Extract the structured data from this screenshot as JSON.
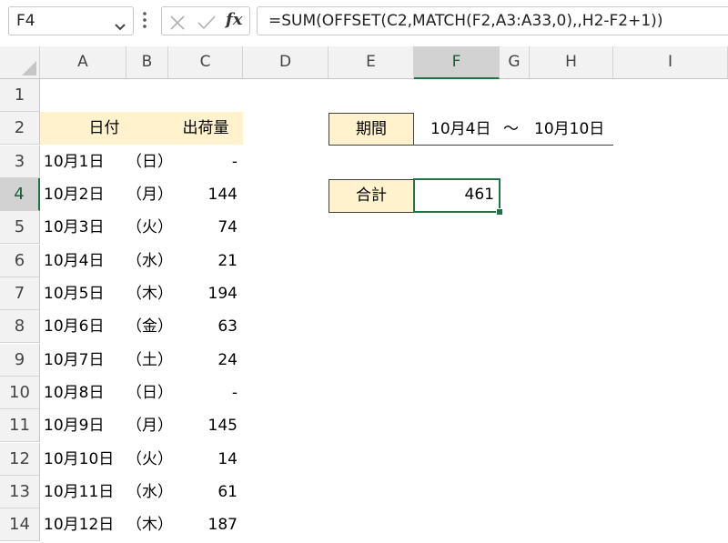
{
  "name_box": {
    "value": "F4"
  },
  "formula_bar": {
    "formula": "=SUM(OFFSET(C2,MATCH(F2,A3:A33,0),,H2-F2+1))"
  },
  "columns": [
    "A",
    "B",
    "C",
    "D",
    "E",
    "F",
    "G",
    "H",
    "I"
  ],
  "selected_column": "F",
  "rows": [
    "1",
    "2",
    "3",
    "4",
    "5",
    "6",
    "7",
    "8",
    "9",
    "10",
    "11",
    "12",
    "13",
    "14"
  ],
  "selected_row": "4",
  "table": {
    "header_date": "日付",
    "header_qty": "出荷量",
    "rows": [
      {
        "date": "10月1日",
        "weekday": "（日）",
        "qty": "-"
      },
      {
        "date": "10月2日",
        "weekday": "（月）",
        "qty": "144"
      },
      {
        "date": "10月3日",
        "weekday": "（火）",
        "qty": "74"
      },
      {
        "date": "10月4日",
        "weekday": "（水）",
        "qty": "21"
      },
      {
        "date": "10月5日",
        "weekday": "（木）",
        "qty": "194"
      },
      {
        "date": "10月6日",
        "weekday": "（金）",
        "qty": "63"
      },
      {
        "date": "10月7日",
        "weekday": "（土）",
        "qty": "24"
      },
      {
        "date": "10月8日",
        "weekday": "（日）",
        "qty": "-"
      },
      {
        "date": "10月9日",
        "weekday": "（月）",
        "qty": "145"
      },
      {
        "date": "10月10日",
        "weekday": "（火）",
        "qty": "14"
      },
      {
        "date": "10月11日",
        "weekday": "（水）",
        "qty": "61"
      },
      {
        "date": "10月12日",
        "weekday": "（木）",
        "qty": "187"
      }
    ]
  },
  "period": {
    "label": "期間",
    "start": "10月4日",
    "tilde": "～",
    "end": "10月10日"
  },
  "total": {
    "label": "合計",
    "value": "461"
  },
  "colors": {
    "header_fill": "#fff2cc",
    "accent_green": "#217346",
    "grid_header_bg": "#f2f2f2"
  }
}
